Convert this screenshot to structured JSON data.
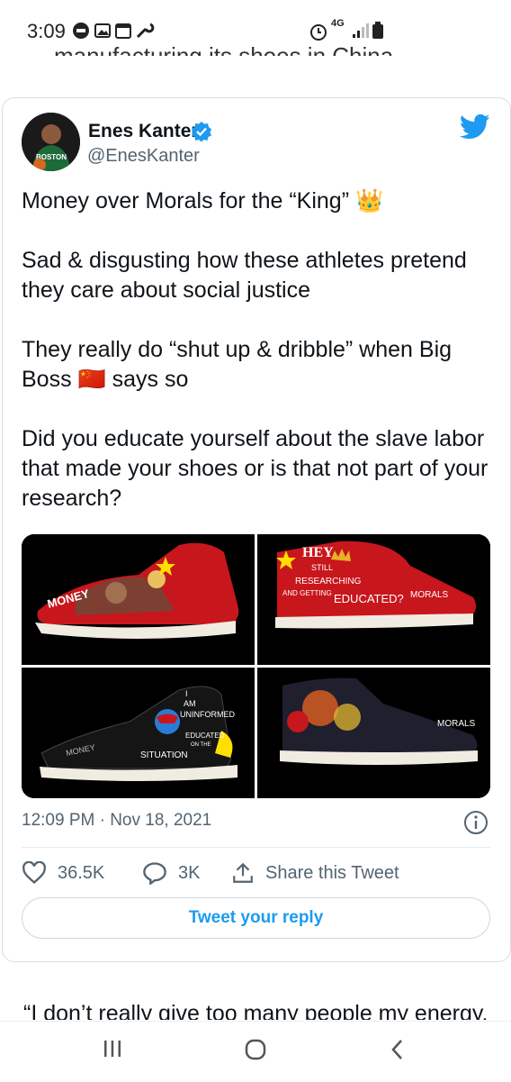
{
  "status_bar": {
    "time": "3:09",
    "network": "4G"
  },
  "previous_text": "manufacturing its shoes in China.",
  "tweet": {
    "author_name": "Enes Kanter",
    "author_handle": "@EnesKanter",
    "avatar_jersey_text": "BOSTON",
    "paragraphs": [
      "Money over Morals for the “King” 👑",
      "Sad & disgusting how these athletes pretend they care about social justice",
      "They really do “shut up & dribble” when Big Boss 🇨🇳 says so",
      "Did you educate yourself about the slave labor that made your shoes or is that not part of your research?"
    ],
    "images": [
      {
        "name": "shoe-image-1",
        "texts": [
          "MONEY"
        ]
      },
      {
        "name": "shoe-image-2",
        "texts": [
          "HEY",
          "STILL",
          "RESEARCHING",
          "AND GETTING",
          "EDUCATED?",
          "MORALS"
        ]
      },
      {
        "name": "shoe-image-3",
        "texts": [
          "I",
          "AM",
          "UNINFORMED",
          "EDUCATED",
          "ON THE",
          "SITUATION",
          "MONEY"
        ]
      },
      {
        "name": "shoe-image-4",
        "texts": [
          "MORALS"
        ]
      }
    ],
    "timestamp": "12:09 PM · Nov 18, 2021",
    "like_count": "36.5K",
    "reply_count": "3K",
    "share_label": "Share this Tweet",
    "reply_button": "Tweet your reply"
  },
  "quote_text": "“I don’t really give too many people my energy.",
  "colors": {
    "twitter_blue": "#1d9bf0",
    "text": "#0f1419",
    "muted": "#536471"
  },
  "icons": [
    "twitter-bird-icon",
    "verified-badge-icon",
    "info-icon",
    "heart-icon",
    "reply-icon",
    "share-icon"
  ]
}
